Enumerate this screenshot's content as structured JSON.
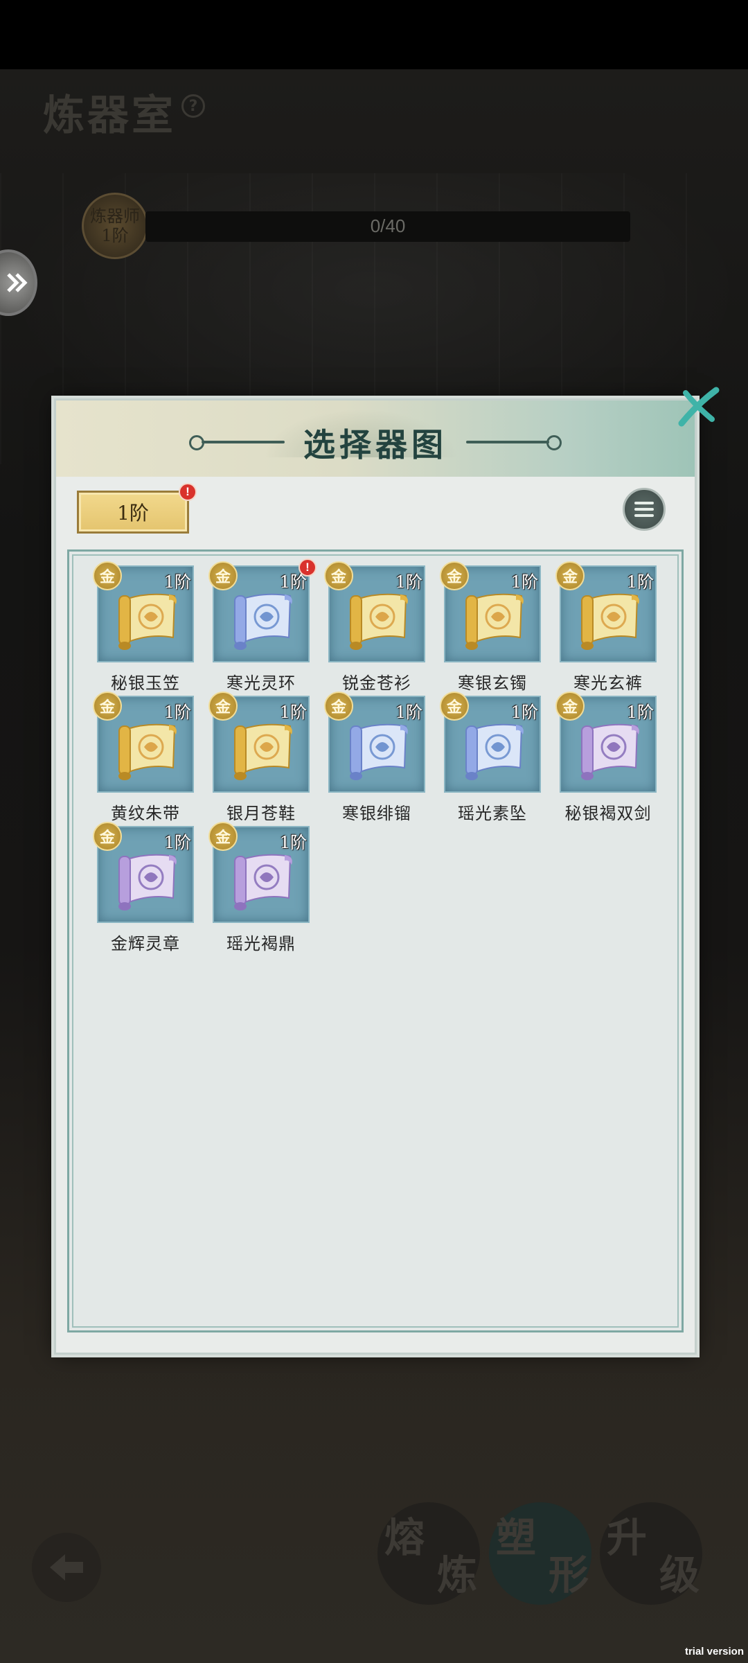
{
  "room": {
    "title": "炼器室",
    "help_icon": "question-icon"
  },
  "rank": {
    "line1": "炼器师",
    "line2": "1阶"
  },
  "progress": {
    "text": "0/40",
    "value": 0,
    "max": 40
  },
  "dialog": {
    "title": "选择器图",
    "tier_filter": "1阶",
    "tier_filter_alert": "!",
    "colors": {
      "header_accent": "#9ec4b7",
      "frame": "#7ea8a3",
      "tile": "#6fa1b4"
    }
  },
  "items": [
    {
      "name": "秘银玉笠",
      "grade": "金",
      "tier": "1阶",
      "scroll": "gold",
      "alert": ""
    },
    {
      "name": "寒光灵环",
      "grade": "金",
      "tier": "1阶",
      "scroll": "blue",
      "alert": "!"
    },
    {
      "name": "锐金苍衫",
      "grade": "金",
      "tier": "1阶",
      "scroll": "gold",
      "alert": ""
    },
    {
      "name": "寒银玄镯",
      "grade": "金",
      "tier": "1阶",
      "scroll": "gold",
      "alert": ""
    },
    {
      "name": "寒光玄裤",
      "grade": "金",
      "tier": "1阶",
      "scroll": "gold",
      "alert": ""
    },
    {
      "name": "黄纹朱带",
      "grade": "金",
      "tier": "1阶",
      "scroll": "gold",
      "alert": ""
    },
    {
      "name": "银月苍鞋",
      "grade": "金",
      "tier": "1阶",
      "scroll": "gold",
      "alert": ""
    },
    {
      "name": "寒银绯镏",
      "grade": "金",
      "tier": "1阶",
      "scroll": "blue",
      "alert": ""
    },
    {
      "name": "瑶光素坠",
      "grade": "金",
      "tier": "1阶",
      "scroll": "blue",
      "alert": ""
    },
    {
      "name": "秘银褐双剑",
      "grade": "金",
      "tier": "1阶",
      "scroll": "purple",
      "alert": ""
    },
    {
      "name": "金辉灵章",
      "grade": "金",
      "tier": "1阶",
      "scroll": "purple",
      "alert": ""
    },
    {
      "name": "瑶光褐鼎",
      "grade": "金",
      "tier": "1阶",
      "scroll": "purple",
      "alert": ""
    }
  ],
  "actions": [
    {
      "top": "熔",
      "bottom": "炼"
    },
    {
      "top": "塑",
      "bottom": "形"
    },
    {
      "top": "升",
      "bottom": "级"
    }
  ],
  "watermark": "trial version"
}
